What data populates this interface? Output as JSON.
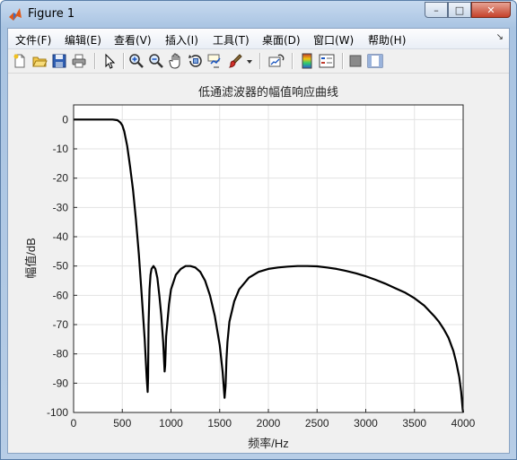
{
  "window": {
    "title": "Figure 1",
    "minimize": "–",
    "maximize": "□",
    "close": "✕"
  },
  "menu": {
    "items": [
      "文件(F)",
      "编辑(E)",
      "查看(V)",
      "插入(I)",
      "工具(T)",
      "桌面(D)",
      "窗口(W)",
      "帮助(H)"
    ],
    "corner": "↘"
  },
  "toolbar": {
    "icons": [
      "new-figure-icon",
      "open-file-icon",
      "save-icon",
      "print-icon",
      "pointer-icon",
      "zoom-in-icon",
      "zoom-out-icon",
      "pan-hand-icon",
      "rotate-3d-icon",
      "data-cursor-icon",
      "brush-icon",
      "brush-dropdown-icon",
      "link-plot-icon",
      "colorbar-icon",
      "legend-icon",
      "hide-plot-tools-icon",
      "show-plot-tools-icon"
    ]
  },
  "chart_data": {
    "type": "line",
    "title": "低通滤波器的幅值响应曲线",
    "xlabel": "频率/Hz",
    "ylabel": "幅值/dB",
    "xlim": [
      0,
      4000
    ],
    "ylim": [
      -100,
      5
    ],
    "xticks": [
      0,
      500,
      1000,
      1500,
      2000,
      2500,
      3000,
      3500,
      4000
    ],
    "yticks": [
      0,
      -10,
      -20,
      -30,
      -40,
      -50,
      -60,
      -70,
      -80,
      -90,
      -100
    ],
    "grid": true,
    "line_color": "#000000",
    "series": [
      {
        "x": [
          0,
          100,
          200,
          300,
          400,
          450,
          480,
          500,
          520,
          550,
          580,
          610,
          640,
          670,
          700,
          730,
          750,
          760,
          765,
          770,
          780,
          790,
          800,
          820,
          840,
          860,
          880,
          900,
          920,
          935,
          940,
          950,
          980,
          1000,
          1050,
          1100,
          1150,
          1200,
          1250,
          1300,
          1350,
          1400,
          1450,
          1500,
          1530,
          1550,
          1560,
          1570,
          1580,
          1600,
          1650,
          1700,
          1800,
          1900,
          2000,
          2100,
          2200,
          2300,
          2400,
          2500,
          2600,
          2700,
          2800,
          2900,
          3000,
          3100,
          3200,
          3300,
          3400,
          3500,
          3600,
          3700,
          3750,
          3800,
          3850,
          3900,
          3930,
          3960,
          3980,
          3995,
          4000
        ],
        "y": [
          0,
          0,
          0,
          0,
          0,
          -0.2,
          -1,
          -2,
          -4,
          -9,
          -16,
          -24,
          -34,
          -46,
          -60,
          -75,
          -88,
          -93,
          -88,
          -70,
          -58,
          -53,
          -51,
          -50,
          -51,
          -54,
          -60,
          -67,
          -76,
          -86,
          -84,
          -74,
          -63,
          -58,
          -53,
          -51,
          -50,
          -50,
          -50.5,
          -52,
          -55,
          -60,
          -67,
          -77,
          -86,
          -95,
          -91,
          -82,
          -76,
          -69,
          -62,
          -58,
          -54,
          -52,
          -51,
          -50.5,
          -50.2,
          -50,
          -50,
          -50.1,
          -50.5,
          -51,
          -51.7,
          -52.5,
          -53.5,
          -54.7,
          -56,
          -57.5,
          -59,
          -61,
          -63.5,
          -67,
          -69,
          -71.5,
          -74.5,
          -79,
          -83,
          -88,
          -93,
          -99,
          -100
        ]
      }
    ]
  }
}
